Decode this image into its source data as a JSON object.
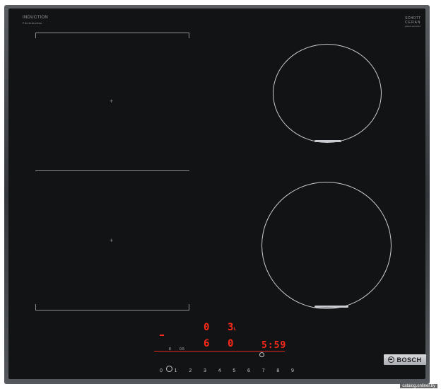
{
  "hob": {
    "mode_label": "INDUCTION",
    "mode_sub": "FlexInduction",
    "glass_brand_line1": "SCHOTT",
    "glass_brand_line2": "CERAN",
    "glass_brand_sub": "glass-ceramic"
  },
  "display": {
    "zone_left_top_value": "0",
    "zone_left_bottom_value": "6",
    "zone_right_top_value": "3",
    "zone_right_top_suffix": "L",
    "zone_right_bottom_value": "0",
    "timer_value": "5:59",
    "small_left_label": "8",
    "small_left_value": "0.5"
  },
  "power_scale": [
    "0",
    "1",
    "2",
    "3",
    "4",
    "5",
    "6",
    "7",
    "8",
    "9"
  ],
  "brand": {
    "name": "BOSCH"
  },
  "watermark": "catalog.onliner.by",
  "colors": {
    "glass": "#121314",
    "display_red": "#ff2a1a",
    "ring": "#c9ccd0",
    "frame": "#4a4d51"
  }
}
